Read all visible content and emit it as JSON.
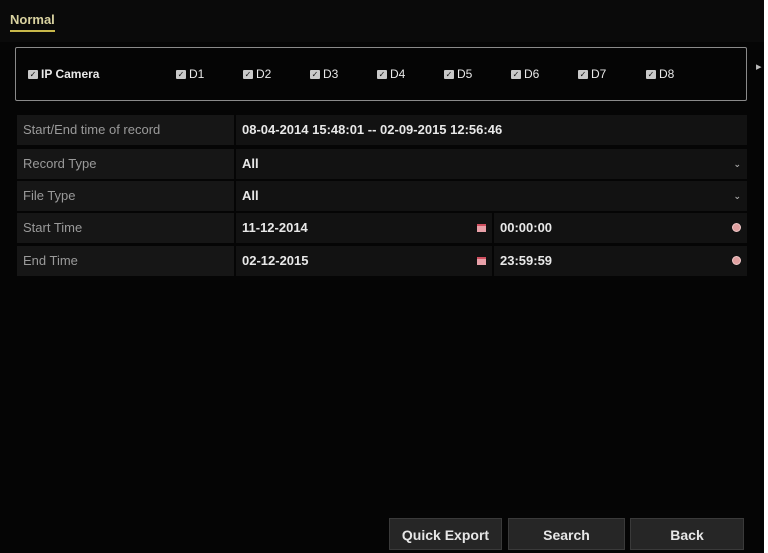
{
  "tabs": [
    {
      "label": "Normal",
      "active": true
    }
  ],
  "camera_filter": {
    "group": {
      "label": "IP Camera",
      "checked": true
    },
    "channels": [
      {
        "label": "D1",
        "checked": true
      },
      {
        "label": "D2",
        "checked": true
      },
      {
        "label": "D3",
        "checked": true
      },
      {
        "label": "D4",
        "checked": true
      },
      {
        "label": "D5",
        "checked": true
      },
      {
        "label": "D6",
        "checked": true
      },
      {
        "label": "D7",
        "checked": true
      },
      {
        "label": "D8",
        "checked": true
      }
    ]
  },
  "form": {
    "record_range": {
      "label": "Start/End time of record",
      "value": "08-04-2014 15:48:01 -- 02-09-2015 12:56:46"
    },
    "record_type": {
      "label": "Record Type",
      "value": "All"
    },
    "file_type": {
      "label": "File Type",
      "value": "All"
    },
    "start_time": {
      "label": "Start Time",
      "date": "11-12-2014",
      "time": "00:00:00"
    },
    "end_time": {
      "label": "End Time",
      "date": "02-12-2015",
      "time": "23:59:59"
    }
  },
  "buttons": {
    "quick_export": "Quick Export",
    "search": "Search",
    "back": "Back"
  },
  "icons": {
    "checkbox": "checkbox-checked-icon",
    "dropdown": "chevron-down-icon",
    "calendar": "calendar-icon",
    "clock": "clock-icon",
    "panel_arrow": "chevron-right-icon"
  },
  "colors": {
    "background": "#050505",
    "tab_accent": "#c8b84a",
    "label_bg": "#161616",
    "value_bg": "#121212",
    "button_bg": "#262626"
  }
}
